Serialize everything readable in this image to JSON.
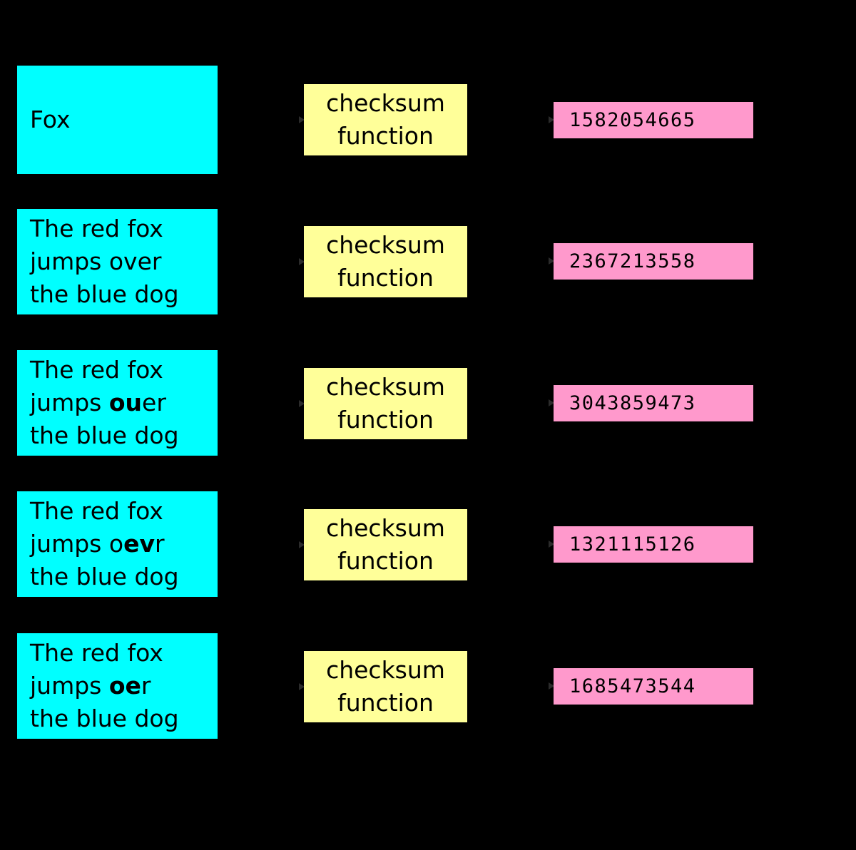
{
  "diagram": {
    "title": "checksum function",
    "colors": {
      "background": "#000000",
      "input_box": "#00ffff",
      "function_box": "#ffff99",
      "checksum_box": "#ff99cc",
      "text": "#000000",
      "arrow": "#2b2b2b"
    },
    "function_label_line1": "checksum",
    "function_label_line2": "function",
    "rows": [
      {
        "input_lines": [
          [
            {
              "text": "Fox",
              "bold": false
            }
          ]
        ],
        "input_plain": "Fox",
        "function_line1": "checksum",
        "function_line2": "function",
        "checksum": "1582054665"
      },
      {
        "input_lines": [
          [
            {
              "text": "The red fox",
              "bold": false
            }
          ],
          [
            {
              "text": "jumps over",
              "bold": false
            }
          ],
          [
            {
              "text": "the blue dog",
              "bold": false
            }
          ]
        ],
        "input_plain": "The red fox jumps over the blue dog",
        "function_line1": "checksum",
        "function_line2": "function",
        "checksum": "2367213558"
      },
      {
        "input_lines": [
          [
            {
              "text": "The red fox",
              "bold": false
            }
          ],
          [
            {
              "text": "jumps ",
              "bold": false
            },
            {
              "text": "ou",
              "bold": true
            },
            {
              "text": "er",
              "bold": false
            }
          ],
          [
            {
              "text": "the blue dog",
              "bold": false
            }
          ]
        ],
        "input_plain": "The red fox jumps ouer the blue dog",
        "function_line1": "checksum",
        "function_line2": "function",
        "checksum": "3043859473"
      },
      {
        "input_lines": [
          [
            {
              "text": "The red fox",
              "bold": false
            }
          ],
          [
            {
              "text": "jumps o",
              "bold": false
            },
            {
              "text": "ev",
              "bold": true
            },
            {
              "text": "r",
              "bold": false
            }
          ],
          [
            {
              "text": "the blue dog",
              "bold": false
            }
          ]
        ],
        "input_plain": "The red fox jumps oevr the blue dog",
        "function_line1": "checksum",
        "function_line2": "function",
        "checksum": "1321115126"
      },
      {
        "input_lines": [
          [
            {
              "text": "The red fox",
              "bold": false
            }
          ],
          [
            {
              "text": "jumps ",
              "bold": false
            },
            {
              "text": "oe",
              "bold": true
            },
            {
              "text": "r",
              "bold": false
            }
          ],
          [
            {
              "text": "the blue dog",
              "bold": false
            }
          ]
        ],
        "input_plain": "The red fox jumps oer the blue dog",
        "function_line1": "checksum",
        "function_line2": "function",
        "checksum": "1685473544"
      }
    ]
  }
}
